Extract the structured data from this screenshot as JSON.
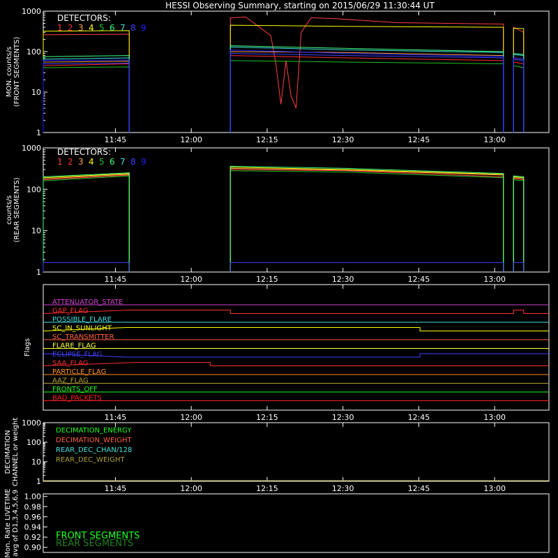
{
  "title": "HESSI Observing Summary, starting on 2015/06/29 11:30:44 UT",
  "time_ticks": [
    "11:45",
    "12:00",
    "12:15",
    "12:30",
    "12:45",
    "13:00"
  ],
  "time_tick_minutes": [
    14.27,
    29.27,
    44.27,
    59.27,
    74.27,
    89.27
  ],
  "time_range_minutes": [
    0,
    100
  ],
  "colors": {
    "det": [
      "#ff4040",
      "#ff3030",
      "#ffa040",
      "#ffff00",
      "#20c020",
      "#40ff80",
      "#40e0e0",
      "#4040ff",
      "#2020ff"
    ],
    "frame": "#ffffff"
  },
  "panels": {
    "front": {
      "ylabel": [
        "MON. counts/s",
        "(FRONT SEGMENTS)"
      ],
      "yticks": [
        "1000",
        "100",
        "10",
        "1"
      ],
      "legend_title": "DETECTORS:",
      "legend_nums": [
        "1",
        "2",
        "3",
        "4",
        "5",
        "6",
        "7",
        "8",
        "9"
      ]
    },
    "rear": {
      "ylabel": [
        "counts/s",
        "(REAR SEGMENTS)"
      ],
      "yticks": [
        "1000",
        "100",
        "10",
        "1"
      ],
      "legend_title": "DETECTORS:",
      "legend_nums": [
        "1",
        "2",
        "3",
        "4",
        "5",
        "6",
        "7",
        "8",
        "9"
      ]
    },
    "flags": {
      "ylabel": "Flags",
      "items": [
        {
          "label": "ATTENUATOR_STATE",
          "color": "#d040d0"
        },
        {
          "label": "GAP_FLAG",
          "color": "#ff3030"
        },
        {
          "label": "POSSIBLE_FLARE",
          "color": "#40e0e0"
        },
        {
          "label": "SC_IN_SUNLIGHT",
          "color": "#ffff00"
        },
        {
          "label": "SC_TRANSMITTER",
          "color": "#ff6040"
        },
        {
          "label": "FLARE_FLAG",
          "color": "#ffff40"
        },
        {
          "label": "ECLIPSE_FLAG",
          "color": "#4040ff"
        },
        {
          "label": "SAA_FLAG",
          "color": "#ff3030"
        },
        {
          "label": "PARTICLE_FLAG",
          "color": "#ff9020"
        },
        {
          "label": "AAZ_FLAG",
          "color": "#b0a030"
        },
        {
          "label": "FRONTS_OFF",
          "color": "#20ff20"
        },
        {
          "label": "BAD_PACKETS",
          "color": "#ff2020"
        }
      ]
    },
    "decim": {
      "ylabel": [
        "DECIMATION",
        "CHANNEL or weight"
      ],
      "yticks": [
        "1000",
        "100",
        "10",
        "1"
      ],
      "legend": [
        {
          "label": "DECIMATION_ENERGY",
          "color": "#20ff20"
        },
        {
          "label": "DECIMATION_WEIGHT",
          "color": "#ff6040"
        },
        {
          "label": "REAR_DEC_CHAN/128",
          "color": "#40e0e0"
        },
        {
          "label": "REAR_DEC_WEIGHT",
          "color": "#b0a030"
        }
      ]
    },
    "livetime": {
      "ylabel": [
        "Mon. Rate LIVETIME",
        "avg of D1,3,4,5,6,9"
      ],
      "yticks": [
        "1.00",
        "0.98",
        "0.96",
        "0.94",
        "0.92",
        "0.90"
      ],
      "legend": [
        {
          "label": "FRONT SEGMENTS",
          "color": "#20ff20"
        },
        {
          "label": "REAR SEGMENTS",
          "color": "#208020"
        }
      ]
    }
  },
  "chart_data": [
    {
      "type": "line",
      "ylabel": "MON. counts/s (FRONT SEGMENTS)",
      "yscale": "log",
      "ylim": [
        1,
        1000
      ],
      "x_unit": "minutes after 2015/06/29 11:30:44 UT",
      "segments": [
        [
          0,
          17
        ],
        [
          37,
          91
        ],
        [
          93,
          95
        ]
      ],
      "series": [
        {
          "name": "1",
          "values": [
            [
              0,
              260
            ],
            [
              17,
              270
            ],
            [
              37,
              680
            ],
            [
              40,
              720
            ],
            [
              45,
              250
            ],
            [
              46,
              50
            ],
            [
              47,
              5
            ],
            [
              48,
              60
            ],
            [
              49,
              8
            ],
            [
              50,
              4
            ],
            [
              51,
              300
            ],
            [
              53,
              690
            ],
            [
              58,
              650
            ],
            [
              70,
              520
            ],
            [
              91,
              480
            ],
            [
              93,
              400
            ],
            [
              95,
              300
            ]
          ]
        },
        {
          "name": "2",
          "values": [
            [
              0,
              45
            ],
            [
              17,
              50
            ],
            [
              37,
              80
            ],
            [
              60,
              70
            ],
            [
              91,
              60
            ],
            [
              93,
              55
            ],
            [
              95,
              50
            ]
          ]
        },
        {
          "name": "3",
          "values": [
            [
              0,
              55
            ],
            [
              17,
              58
            ],
            [
              37,
              100
            ],
            [
              60,
              95
            ],
            [
              91,
              80
            ],
            [
              93,
              70
            ],
            [
              95,
              65
            ]
          ]
        },
        {
          "name": "4",
          "values": [
            [
              0,
              320
            ],
            [
              17,
              330
            ],
            [
              37,
              450
            ],
            [
              45,
              440
            ],
            [
              60,
              420
            ],
            [
              91,
              400
            ],
            [
              93,
              380
            ],
            [
              95,
              370
            ]
          ]
        },
        {
          "name": "5",
          "values": [
            [
              0,
              40
            ],
            [
              17,
              42
            ],
            [
              37,
              60
            ],
            [
              60,
              55
            ],
            [
              91,
              50
            ],
            [
              93,
              45
            ],
            [
              95,
              40
            ]
          ]
        },
        {
          "name": "6",
          "values": [
            [
              0,
              75
            ],
            [
              17,
              80
            ],
            [
              37,
              140
            ],
            [
              60,
              120
            ],
            [
              91,
              100
            ],
            [
              93,
              90
            ],
            [
              95,
              85
            ]
          ]
        },
        {
          "name": "7",
          "values": [
            [
              0,
              65
            ],
            [
              17,
              70
            ],
            [
              37,
              130
            ],
            [
              60,
              110
            ],
            [
              91,
              95
            ],
            [
              93,
              85
            ],
            [
              95,
              80
            ]
          ]
        },
        {
          "name": "8",
          "values": [
            [
              0,
              50
            ],
            [
              17,
              52
            ],
            [
              37,
              90
            ],
            [
              60,
              80
            ],
            [
              91,
              70
            ],
            [
              93,
              65
            ],
            [
              95,
              60
            ]
          ]
        },
        {
          "name": "9",
          "values": [
            [
              0,
              60
            ],
            [
              17,
              62
            ],
            [
              37,
              110
            ],
            [
              60,
              90
            ],
            [
              91,
              75
            ],
            [
              93,
              70
            ],
            [
              95,
              65
            ]
          ]
        }
      ]
    },
    {
      "type": "line",
      "ylabel": "counts/s (REAR SEGMENTS)",
      "yscale": "log",
      "ylim": [
        1,
        1000
      ],
      "x_unit": "minutes after 2015/06/29 11:30:44 UT",
      "segments": [
        [
          0,
          17
        ],
        [
          37,
          91
        ],
        [
          93,
          95
        ]
      ],
      "series": [
        {
          "name": "1",
          "values": [
            [
              0,
              170
            ],
            [
              17,
              220
            ],
            [
              37,
              300
            ],
            [
              60,
              280
            ],
            [
              91,
              200
            ],
            [
              93,
              180
            ],
            [
              95,
              170
            ]
          ]
        },
        {
          "name": "3",
          "values": [
            [
              0,
              180
            ],
            [
              17,
              230
            ],
            [
              37,
              320
            ],
            [
              60,
              290
            ],
            [
              91,
              220
            ],
            [
              93,
              190
            ],
            [
              95,
              180
            ]
          ]
        },
        {
          "name": "4",
          "values": [
            [
              0,
              190
            ],
            [
              17,
              240
            ],
            [
              37,
              340
            ],
            [
              60,
              300
            ],
            [
              91,
              230
            ],
            [
              93,
              200
            ],
            [
              95,
              190
            ]
          ]
        },
        {
          "name": "5",
          "values": [
            [
              0,
              160
            ],
            [
              17,
              210
            ],
            [
              37,
              280
            ],
            [
              60,
              260
            ],
            [
              91,
              190
            ],
            [
              93,
              170
            ],
            [
              95,
              160
            ]
          ]
        },
        {
          "name": "6",
          "values": [
            [
              0,
              200
            ],
            [
              17,
              250
            ],
            [
              37,
              360
            ],
            [
              60,
              320
            ],
            [
              91,
              240
            ],
            [
              93,
              210
            ],
            [
              95,
              200
            ]
          ]
        },
        {
          "name": "8",
          "values": [
            [
              0,
              1.7
            ],
            [
              17,
              1.7
            ],
            [
              37,
              1.7
            ],
            [
              60,
              1.7
            ],
            [
              91,
              1.7
            ],
            [
              93,
              1.7
            ],
            [
              95,
              1.7
            ]
          ]
        }
      ]
    },
    {
      "type": "line",
      "ylabel": "Flags",
      "x_unit": "minutes after 2015/06/29 11:30:44 UT",
      "series": [
        {
          "name": "ATTENUATOR_STATE",
          "values": [
            [
              0,
              0
            ],
            [
              100,
              0
            ]
          ]
        },
        {
          "name": "GAP_FLAG",
          "values": [
            [
              0,
              0
            ],
            [
              17,
              1
            ],
            [
              37,
              1
            ],
            [
              37,
              0
            ],
            [
              93,
              0
            ],
            [
              93,
              1
            ],
            [
              95,
              1
            ],
            [
              95,
              0
            ],
            [
              100,
              0
            ]
          ]
        },
        {
          "name": "POSSIBLE_FLARE",
          "values": [
            [
              0,
              0
            ],
            [
              100,
              0
            ]
          ]
        },
        {
          "name": "SC_IN_SUNLIGHT",
          "values": [
            [
              0,
              0
            ],
            [
              16.5,
              1
            ],
            [
              74.5,
              1
            ],
            [
              74.5,
              0
            ],
            [
              100,
              0
            ]
          ]
        },
        {
          "name": "SC_TRANSMITTER",
          "values": [
            [
              0,
              0
            ],
            [
              100,
              0
            ]
          ]
        },
        {
          "name": "FLARE_FLAG",
          "values": [
            [
              0,
              0
            ],
            [
              100,
              0
            ]
          ]
        },
        {
          "name": "ECLIPSE_FLAG",
          "values": [
            [
              0,
              1
            ],
            [
              16.5,
              0
            ],
            [
              74.5,
              0
            ],
            [
              74.5,
              1
            ],
            [
              100,
              1
            ]
          ]
        },
        {
          "name": "SAA_FLAG",
          "values": [
            [
              0,
              0
            ],
            [
              19,
              1
            ],
            [
              33,
              1
            ],
            [
              33,
              0
            ],
            [
              100,
              0
            ]
          ]
        },
        {
          "name": "PARTICLE_FLAG",
          "values": [
            [
              0,
              0
            ],
            [
              100,
              0
            ]
          ]
        },
        {
          "name": "AAZ_FLAG",
          "values": [
            [
              0,
              0
            ],
            [
              100,
              0
            ]
          ]
        },
        {
          "name": "FRONTS_OFF",
          "values": [
            [
              0,
              0
            ],
            [
              100,
              0
            ]
          ]
        },
        {
          "name": "BAD_PACKETS",
          "values": [
            [
              0,
              0
            ],
            [
              100,
              0
            ]
          ]
        }
      ]
    },
    {
      "type": "line",
      "ylabel": "DECIMATION CHANNEL or weight",
      "yscale": "log",
      "ylim": [
        1,
        1000
      ],
      "x_unit": "minutes after 2015/06/29 11:30:44 UT",
      "series": [
        {
          "name": "REAR_DEC_WEIGHT",
          "values": [
            [
              0,
              1
            ],
            [
              100,
              1
            ]
          ]
        }
      ]
    },
    {
      "type": "line",
      "ylabel": "Mon. Rate LIVETIME avg of D1,3,4,5,6,9",
      "ylim": [
        0.89,
        1.005
      ],
      "x_unit": "minutes after 2015/06/29 11:30:44 UT",
      "series": []
    }
  ]
}
